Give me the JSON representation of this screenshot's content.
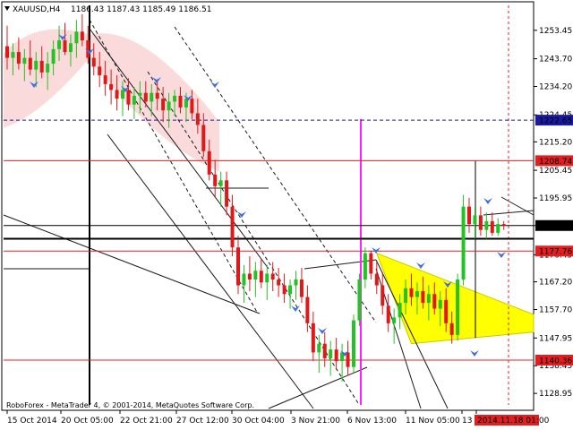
{
  "header": {
    "symbol": "XAUUSD,H4",
    "ohlc": "1186.43 1187.43 1185.49 1186.51"
  },
  "footer": {
    "copyright": "RoboForex - MetaTrader 4, © 2001-2014, MetaQuotes Software Corp."
  },
  "colors": {
    "candle_up": "#22c322",
    "candle_down": "#e01818",
    "level_line": "#e02020",
    "support_line": "#000000",
    "forecast": "#ff22ff",
    "triangle_fill": "#ffff00",
    "shade": "#f9d6d6",
    "arrow": "#3b6fe0",
    "price_label_bg": "#e02020",
    "current_price_bg": "#000000",
    "channel": "#1a1a1a"
  },
  "chart_data": {
    "type": "candlestick",
    "instrument": "XAUUSD",
    "timeframe": "H4",
    "ylim": [
      1125.0,
      1262.0
    ],
    "y_ticks": [
      1253.45,
      1243.7,
      1234.2,
      1224.45,
      1215.2,
      1205.45,
      1195.95,
      1186.51,
      1176.45,
      1167.2,
      1157.7,
      1147.95,
      1138.45,
      1128.95
    ],
    "x_ticks": [
      "15 Oct 2014",
      "20 Oct 05:00",
      "22 Oct 21:00",
      "27 Oct 12:00",
      "30 Oct 04:00",
      "3 Nov 21:00",
      "6 Nov 13:00",
      "11 Nov 05:00",
      "13",
      "2014.11.18 01:00"
    ],
    "levels": [
      {
        "label": "1222.65",
        "value": 1222.65,
        "style": "dashed",
        "color": "#1a1aa0"
      },
      {
        "label": "1208.74",
        "value": 1208.74,
        "style": "solid",
        "color": "#e02020"
      },
      {
        "label": "1186.51",
        "value": 1186.51,
        "style": "current",
        "color": "#000000"
      },
      {
        "label": "1177.76",
        "value": 1177.76,
        "style": "solid",
        "color": "#e02020"
      },
      {
        "label": "1140.36",
        "value": 1140.36,
        "style": "solid",
        "color": "#e02020"
      }
    ],
    "support_value": 1182.0,
    "candles": [
      {
        "o": 1248,
        "h": 1255,
        "l": 1240,
        "c": 1244
      },
      {
        "o": 1244,
        "h": 1249,
        "l": 1238,
        "c": 1246
      },
      {
        "o": 1246,
        "h": 1251,
        "l": 1240,
        "c": 1242
      },
      {
        "o": 1242,
        "h": 1247,
        "l": 1236,
        "c": 1244
      },
      {
        "o": 1244,
        "h": 1250,
        "l": 1238,
        "c": 1240
      },
      {
        "o": 1240,
        "h": 1246,
        "l": 1234,
        "c": 1243
      },
      {
        "o": 1243,
        "h": 1248,
        "l": 1237,
        "c": 1239
      },
      {
        "o": 1239,
        "h": 1246,
        "l": 1233,
        "c": 1242
      },
      {
        "o": 1242,
        "h": 1250,
        "l": 1238,
        "c": 1247
      },
      {
        "o": 1247,
        "h": 1255,
        "l": 1243,
        "c": 1250
      },
      {
        "o": 1250,
        "h": 1256,
        "l": 1245,
        "c": 1246
      },
      {
        "o": 1246,
        "h": 1252,
        "l": 1241,
        "c": 1249
      },
      {
        "o": 1249,
        "h": 1257,
        "l": 1244,
        "c": 1253
      },
      {
        "o": 1253,
        "h": 1259,
        "l": 1248,
        "c": 1250
      },
      {
        "o": 1250,
        "h": 1255,
        "l": 1242,
        "c": 1244
      },
      {
        "o": 1244,
        "h": 1249,
        "l": 1238,
        "c": 1241
      },
      {
        "o": 1241,
        "h": 1246,
        "l": 1234,
        "c": 1238
      },
      {
        "o": 1238,
        "h": 1243,
        "l": 1231,
        "c": 1235
      },
      {
        "o": 1235,
        "h": 1240,
        "l": 1228,
        "c": 1233
      },
      {
        "o": 1233,
        "h": 1238,
        "l": 1226,
        "c": 1230
      },
      {
        "o": 1230,
        "h": 1236,
        "l": 1224,
        "c": 1233
      },
      {
        "o": 1233,
        "h": 1237,
        "l": 1226,
        "c": 1228
      },
      {
        "o": 1228,
        "h": 1234,
        "l": 1223,
        "c": 1231
      },
      {
        "o": 1231,
        "h": 1236,
        "l": 1225,
        "c": 1232
      },
      {
        "o": 1232,
        "h": 1236,
        "l": 1227,
        "c": 1229
      },
      {
        "o": 1229,
        "h": 1235,
        "l": 1224,
        "c": 1232
      },
      {
        "o": 1232,
        "h": 1236,
        "l": 1226,
        "c": 1230
      },
      {
        "o": 1230,
        "h": 1234,
        "l": 1222,
        "c": 1226
      },
      {
        "o": 1226,
        "h": 1232,
        "l": 1220,
        "c": 1229
      },
      {
        "o": 1229,
        "h": 1233,
        "l": 1224,
        "c": 1231
      },
      {
        "o": 1231,
        "h": 1234,
        "l": 1225,
        "c": 1227
      },
      {
        "o": 1227,
        "h": 1232,
        "l": 1222,
        "c": 1230
      },
      {
        "o": 1230,
        "h": 1233,
        "l": 1223,
        "c": 1225
      },
      {
        "o": 1225,
        "h": 1230,
        "l": 1218,
        "c": 1221
      },
      {
        "o": 1221,
        "h": 1225,
        "l": 1210,
        "c": 1212
      },
      {
        "o": 1212,
        "h": 1216,
        "l": 1202,
        "c": 1204
      },
      {
        "o": 1204,
        "h": 1209,
        "l": 1196,
        "c": 1200
      },
      {
        "o": 1200,
        "h": 1205,
        "l": 1193,
        "c": 1202
      },
      {
        "o": 1202,
        "h": 1205,
        "l": 1190,
        "c": 1193
      },
      {
        "o": 1193,
        "h": 1197,
        "l": 1176,
        "c": 1179
      },
      {
        "o": 1179,
        "h": 1183,
        "l": 1163,
        "c": 1166
      },
      {
        "o": 1166,
        "h": 1173,
        "l": 1160,
        "c": 1170
      },
      {
        "o": 1170,
        "h": 1176,
        "l": 1164,
        "c": 1168
      },
      {
        "o": 1168,
        "h": 1174,
        "l": 1162,
        "c": 1171
      },
      {
        "o": 1171,
        "h": 1175,
        "l": 1165,
        "c": 1167
      },
      {
        "o": 1167,
        "h": 1173,
        "l": 1161,
        "c": 1170
      },
      {
        "o": 1170,
        "h": 1174,
        "l": 1164,
        "c": 1168
      },
      {
        "o": 1168,
        "h": 1172,
        "l": 1162,
        "c": 1166
      },
      {
        "o": 1166,
        "h": 1170,
        "l": 1160,
        "c": 1163
      },
      {
        "o": 1163,
        "h": 1168,
        "l": 1158,
        "c": 1166
      },
      {
        "o": 1166,
        "h": 1171,
        "l": 1161,
        "c": 1168
      },
      {
        "o": 1168,
        "h": 1172,
        "l": 1160,
        "c": 1162
      },
      {
        "o": 1162,
        "h": 1166,
        "l": 1150,
        "c": 1153
      },
      {
        "o": 1153,
        "h": 1157,
        "l": 1140,
        "c": 1143
      },
      {
        "o": 1143,
        "h": 1149,
        "l": 1136,
        "c": 1146
      },
      {
        "o": 1146,
        "h": 1150,
        "l": 1138,
        "c": 1141
      },
      {
        "o": 1141,
        "h": 1147,
        "l": 1135,
        "c": 1144
      },
      {
        "o": 1144,
        "h": 1148,
        "l": 1137,
        "c": 1140
      },
      {
        "o": 1140,
        "h": 1146,
        "l": 1133,
        "c": 1143
      },
      {
        "o": 1143,
        "h": 1147,
        "l": 1135,
        "c": 1138
      },
      {
        "o": 1138,
        "h": 1156,
        "l": 1136,
        "c": 1154
      },
      {
        "o": 1154,
        "h": 1170,
        "l": 1152,
        "c": 1168
      },
      {
        "o": 1168,
        "h": 1179,
        "l": 1165,
        "c": 1177
      },
      {
        "o": 1177,
        "h": 1178,
        "l": 1168,
        "c": 1170
      },
      {
        "o": 1170,
        "h": 1174,
        "l": 1163,
        "c": 1166
      },
      {
        "o": 1166,
        "h": 1170,
        "l": 1156,
        "c": 1159
      },
      {
        "o": 1159,
        "h": 1163,
        "l": 1150,
        "c": 1153
      },
      {
        "o": 1153,
        "h": 1158,
        "l": 1146,
        "c": 1155
      },
      {
        "o": 1155,
        "h": 1163,
        "l": 1151,
        "c": 1160
      },
      {
        "o": 1160,
        "h": 1168,
        "l": 1156,
        "c": 1165
      },
      {
        "o": 1165,
        "h": 1170,
        "l": 1159,
        "c": 1162
      },
      {
        "o": 1162,
        "h": 1167,
        "l": 1156,
        "c": 1164
      },
      {
        "o": 1164,
        "h": 1169,
        "l": 1158,
        "c": 1160
      },
      {
        "o": 1160,
        "h": 1166,
        "l": 1154,
        "c": 1163
      },
      {
        "o": 1163,
        "h": 1167,
        "l": 1156,
        "c": 1158
      },
      {
        "o": 1158,
        "h": 1164,
        "l": 1152,
        "c": 1161
      },
      {
        "o": 1161,
        "h": 1165,
        "l": 1150,
        "c": 1153
      },
      {
        "o": 1153,
        "h": 1157,
        "l": 1146,
        "c": 1149
      },
      {
        "o": 1149,
        "h": 1170,
        "l": 1147,
        "c": 1168
      },
      {
        "o": 1168,
        "h": 1197,
        "l": 1166,
        "c": 1193
      },
      {
        "o": 1193,
        "h": 1196,
        "l": 1184,
        "c": 1187
      },
      {
        "o": 1187,
        "h": 1193,
        "l": 1182,
        "c": 1190
      },
      {
        "o": 1190,
        "h": 1193,
        "l": 1183,
        "c": 1185
      },
      {
        "o": 1185,
        "h": 1191,
        "l": 1182,
        "c": 1188
      },
      {
        "o": 1188,
        "h": 1191,
        "l": 1183,
        "c": 1184
      },
      {
        "o": 1184,
        "h": 1189,
        "l": 1183,
        "c": 1187
      },
      {
        "o": 1187,
        "h": 1188,
        "l": 1185,
        "c": 1186.5
      }
    ]
  }
}
